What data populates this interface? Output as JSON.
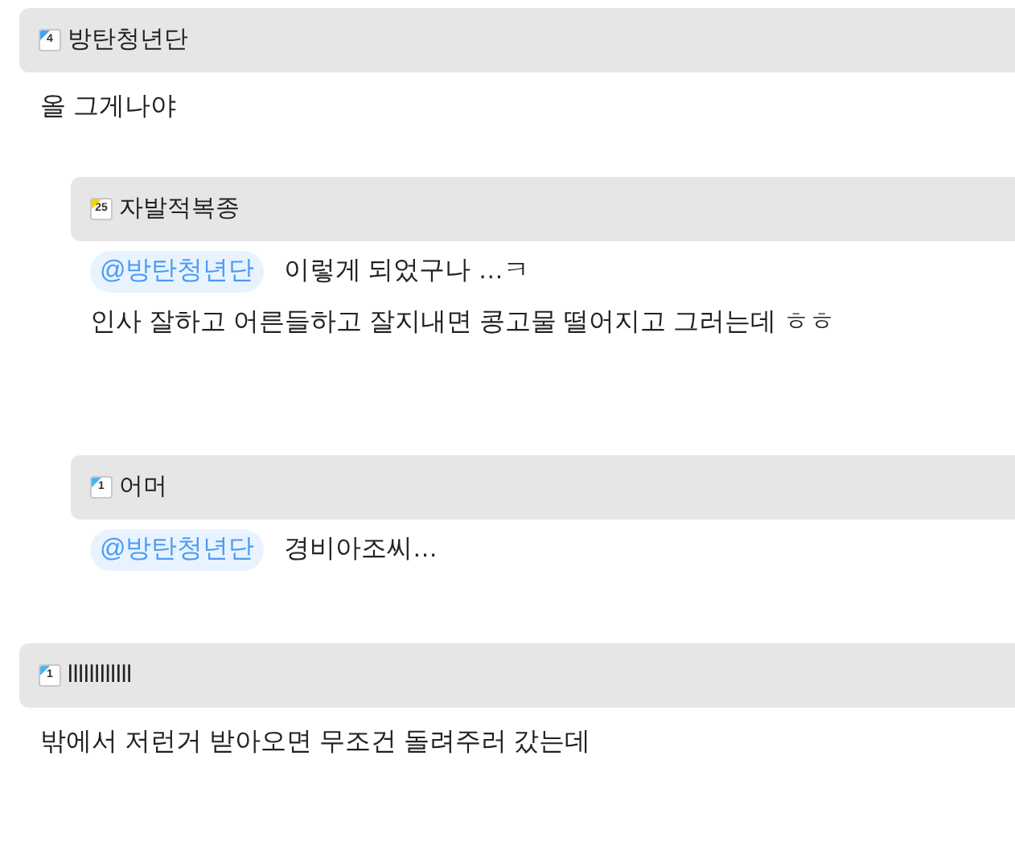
{
  "comments": [
    {
      "user": "방탄청년단",
      "badge": {
        "text": "4",
        "color": "#4a9ff0"
      },
      "lines": [
        "올 그게나야"
      ],
      "replies": [
        {
          "user": "자발적복종",
          "badge": {
            "text": "25",
            "color": "#f2d400"
          },
          "mention": "@방탄청년단",
          "lines": [
            "이렇게 되었구나 …ㅋ",
            "인사 잘하고 어른들하고 잘지내면 콩고물 떨어지고 그러는데 ㅎㅎ"
          ]
        },
        {
          "user": "어머",
          "badge": {
            "text": "1",
            "color": "#4ab4f0"
          },
          "mention": "@방탄청년단",
          "lines": [
            "경비아조씨…"
          ]
        }
      ]
    },
    {
      "user": "llllllllllll",
      "badge": {
        "text": "1",
        "color": "#4ab4f0"
      },
      "lines": [
        "밖에서 저런거 받아오면 무조건 돌려주러 갔는데"
      ]
    }
  ]
}
